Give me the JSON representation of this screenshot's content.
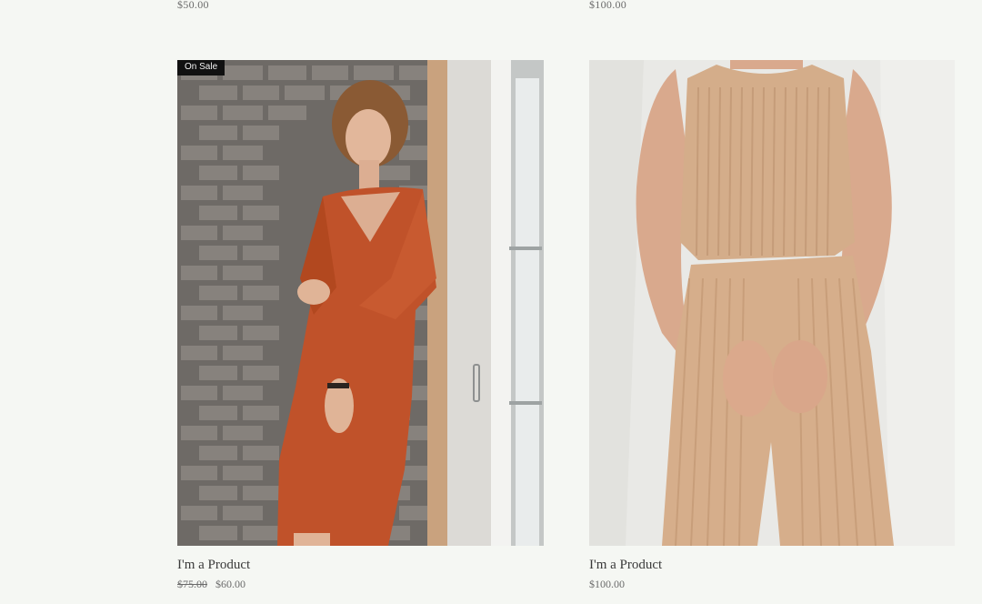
{
  "previous_row": {
    "left_price": "$50.00",
    "right_price": "$100.00"
  },
  "products": [
    {
      "badge": "On Sale",
      "name": "I'm a Product",
      "original_price": "$75.00",
      "sale_price": "$60.00"
    },
    {
      "name": "I'm a Product",
      "price": "$100.00"
    }
  ],
  "colors": {
    "page_background": "#f5f7f3",
    "badge_background": "#111111",
    "dress": "#c0522a",
    "knit_set": "#d4ad8a"
  }
}
